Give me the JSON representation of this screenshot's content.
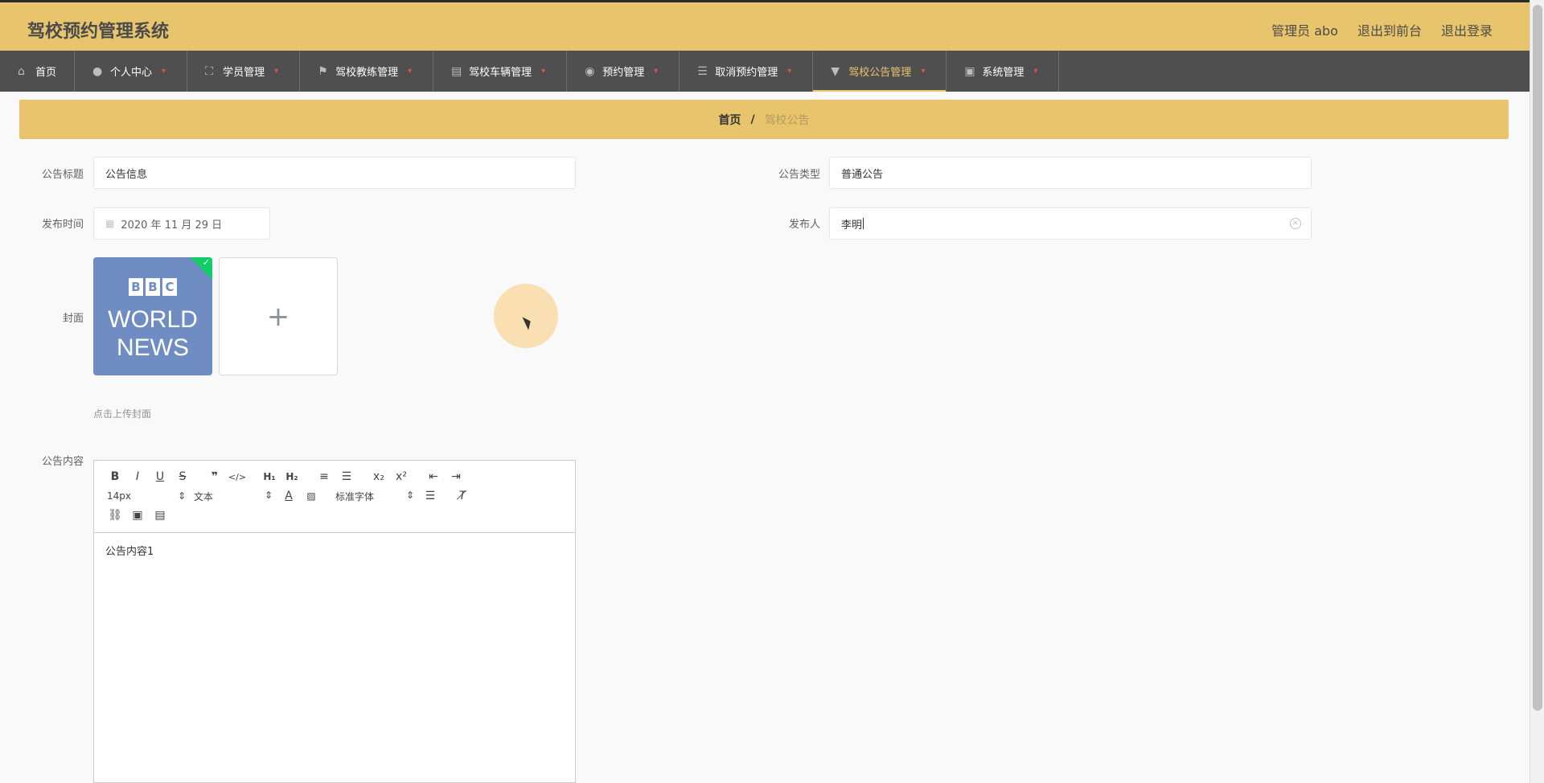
{
  "header": {
    "title": "驾校预约管理系统",
    "admin_label": "管理员 abo",
    "front_link": "退出到前台",
    "logout_link": "退出登录"
  },
  "nav": {
    "items": [
      {
        "label": "首页",
        "icon": "home-icon"
      },
      {
        "label": "个人中心",
        "icon": "user-icon"
      },
      {
        "label": "学员管理",
        "icon": "expand-icon"
      },
      {
        "label": "驾校教练管理",
        "icon": "flag-icon"
      },
      {
        "label": "驾校车辆管理",
        "icon": "clipboard-icon"
      },
      {
        "label": "预约管理",
        "icon": "location-icon"
      },
      {
        "label": "取消预约管理",
        "icon": "sliders-icon"
      },
      {
        "label": "驾校公告管理",
        "icon": "pin-icon"
      },
      {
        "label": "系统管理",
        "icon": "chart-icon"
      }
    ]
  },
  "breadcrumb": {
    "home": "首页",
    "separator": "/",
    "current": "驾校公告"
  },
  "form": {
    "title_label": "公告标题",
    "title_value": "公告信息",
    "type_label": "公告类型",
    "type_value": "普通公告",
    "date_label": "发布时间",
    "date_value": "2020 年 11 月 29 日",
    "publisher_label": "发布人",
    "publisher_value": "李明",
    "cover_label": "封面",
    "cover_hint": "点击上传封面",
    "content_label": "公告内容",
    "cover_image_text": {
      "b1": "B",
      "b2": "B",
      "c": "C",
      "world": "WORLD",
      "news": "NEWS"
    }
  },
  "editor": {
    "font_size": "14px",
    "format": "文本",
    "font_family": "标准字体",
    "content": "公告内容1"
  },
  "colors": {
    "accent": "#e8c56d",
    "nav_bg": "#4f4f4f",
    "success": "#13ce66"
  }
}
